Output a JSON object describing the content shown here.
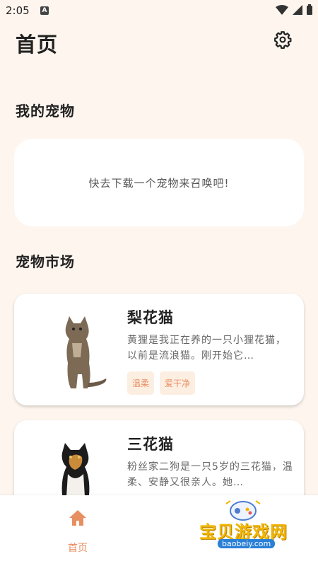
{
  "status_bar": {
    "time": "2:05",
    "notification_letter": "A"
  },
  "header": {
    "title": "首页",
    "settings_icon": "gear-icon"
  },
  "my_pets": {
    "title": "我的宠物",
    "empty_message": "快去下载一个宠物来召唤吧!"
  },
  "market": {
    "title": "宠物市场",
    "pets": [
      {
        "name": "梨花猫",
        "description": "黄狸是我正在养的一只小狸花猫，以前是流浪猫。刚开始它…",
        "tags": [
          "温柔",
          "爱干净"
        ]
      },
      {
        "name": "三花猫",
        "description": "粉丝家二狗是一只5岁的三花猫，温柔、安静又很亲人。她…",
        "tags": []
      }
    ]
  },
  "bottom_nav": {
    "home_label": "首页",
    "home_icon": "home-icon"
  },
  "watermark": {
    "title": "宝贝游戏网",
    "url": "baobeiy.com"
  },
  "colors": {
    "accent": "#e88f62",
    "background": "#fdf5ee",
    "tag_bg": "#fdeee2"
  }
}
